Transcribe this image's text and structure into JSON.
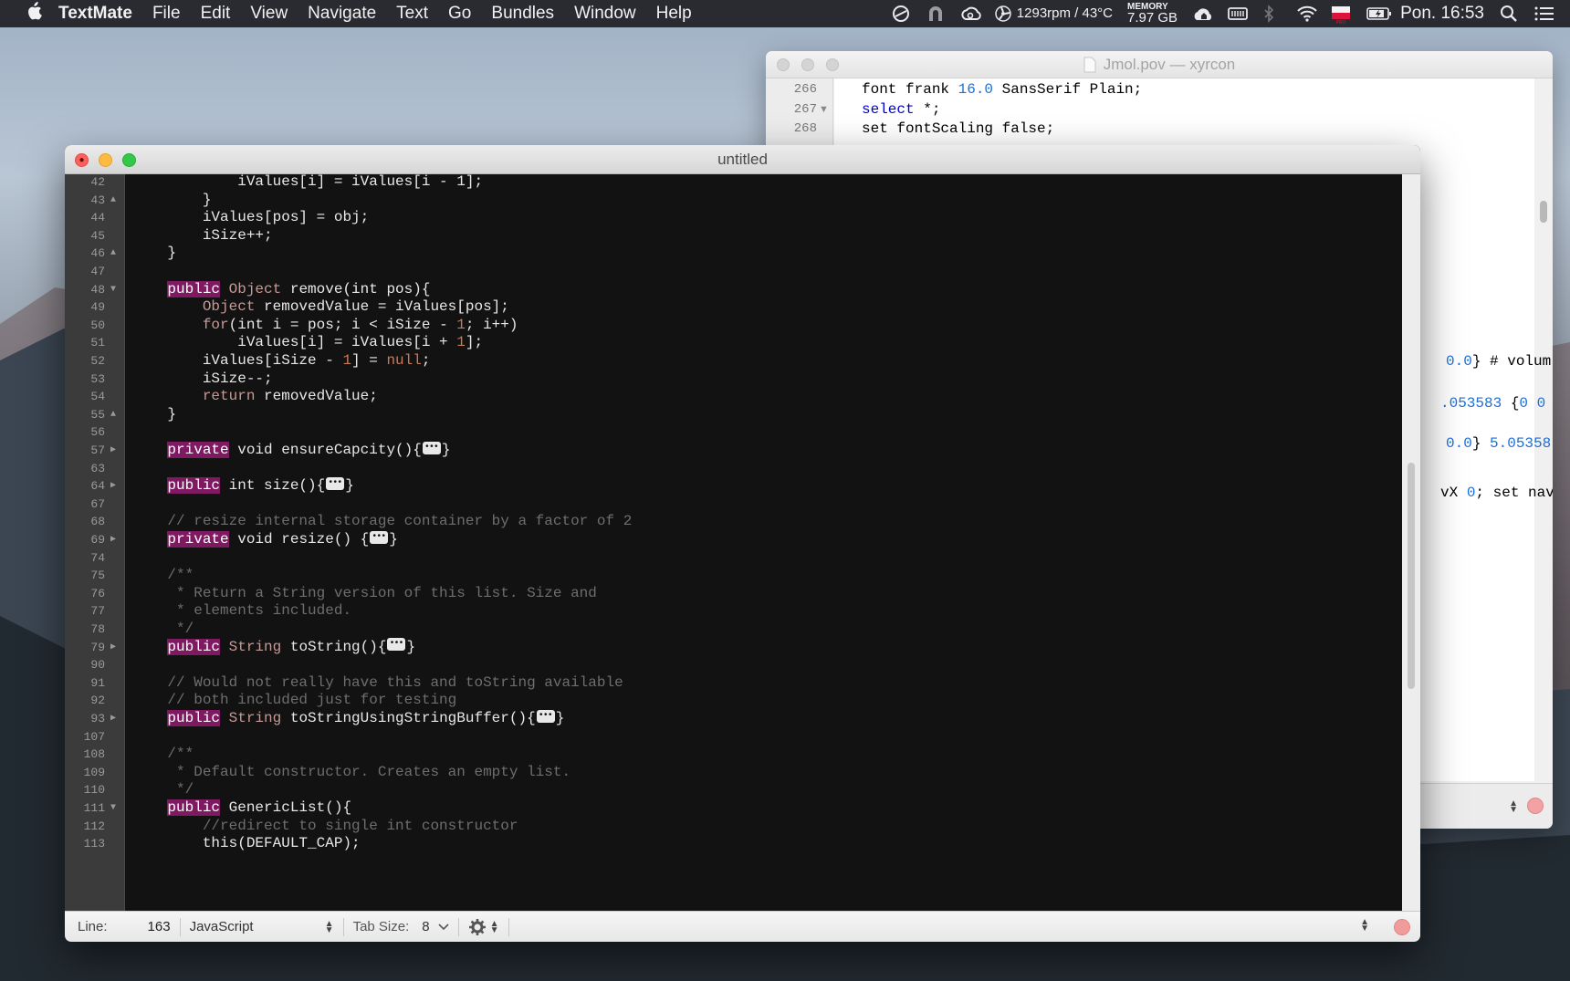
{
  "menubar": {
    "app_name": "TextMate",
    "menus": [
      "File",
      "Edit",
      "View",
      "Navigate",
      "Text",
      "Go",
      "Bundles",
      "Window",
      "Help"
    ],
    "fan_status": "1293rpm / 43°C",
    "memory_label": "MEMORY",
    "memory_value": "7.97 GB",
    "clock": "Pon. 16:53"
  },
  "back_window": {
    "title": "Jmol.pov — xyrcon",
    "lines": [
      {
        "num": "266",
        "fold": "",
        "segments": [
          {
            "t": "font frank ",
            "c": ""
          },
          {
            "t": "16.0",
            "c": "num"
          },
          {
            "t": " SansSerif Plain;",
            "c": ""
          }
        ]
      },
      {
        "num": "267",
        "fold": "▼",
        "segments": [
          {
            "t": "select",
            "c": "kw"
          },
          {
            "t": " *;",
            "c": ""
          }
        ]
      },
      {
        "num": "268",
        "fold": "",
        "segments": [
          {
            "t": "set fontScaling false;",
            "c": ""
          }
        ]
      }
    ],
    "peek_lines": [
      {
        "segments": [
          {
            "t": "0.0",
            "c": "num"
          },
          {
            "t": "} # volum",
            "c": ""
          }
        ]
      },
      {
        "segments": [
          {
            "t": ".053583",
            "c": "num"
          },
          {
            "t": " {",
            "c": ""
          },
          {
            "t": "0 0",
            "c": "num"
          }
        ]
      },
      {
        "segments": [
          {
            "t": "0.0",
            "c": "num"
          },
          {
            "t": "} ",
            "c": ""
          },
          {
            "t": "5.05358",
            "c": "num"
          }
        ]
      },
      {
        "segments": [
          {
            "t": "vX ",
            "c": ""
          },
          {
            "t": "0",
            "c": "num"
          },
          {
            "t": "; set nav",
            "c": ""
          }
        ]
      }
    ]
  },
  "front_window": {
    "title": "untitled",
    "lines": [
      {
        "num": "42",
        "fold": "",
        "segments": [
          {
            "t": "            iValues[i] = iValues[i - 1];",
            "c": "plain"
          }
        ]
      },
      {
        "num": "43",
        "fold": "▲",
        "segments": [
          {
            "t": "        }",
            "c": "plain"
          }
        ]
      },
      {
        "num": "44",
        "fold": "",
        "segments": [
          {
            "t": "        iValues[pos] = obj;",
            "c": "plain"
          }
        ]
      },
      {
        "num": "45",
        "fold": "",
        "segments": [
          {
            "t": "        iSize++;",
            "c": "plain"
          }
        ]
      },
      {
        "num": "46",
        "fold": "▲",
        "segments": [
          {
            "t": "    }",
            "c": "plain"
          }
        ]
      },
      {
        "num": "47",
        "fold": "",
        "segments": []
      },
      {
        "num": "48",
        "fold": "▼",
        "segments": [
          {
            "t": "    ",
            "c": "plain"
          },
          {
            "t": "public",
            "c": "kw"
          },
          {
            "t": " ",
            "c": "plain"
          },
          {
            "t": "Object",
            "c": "cl"
          },
          {
            "t": " remove(int pos){",
            "c": "plain"
          }
        ]
      },
      {
        "num": "49",
        "fold": "",
        "segments": [
          {
            "t": "        ",
            "c": "plain"
          },
          {
            "t": "Object",
            "c": "cl"
          },
          {
            "t": " removedValue = iValues[pos];",
            "c": "plain"
          }
        ]
      },
      {
        "num": "50",
        "fold": "",
        "segments": [
          {
            "t": "        ",
            "c": "plain"
          },
          {
            "t": "for",
            "c": "ctl"
          },
          {
            "t": "(int i = pos; i < iSize - ",
            "c": "plain"
          },
          {
            "t": "1",
            "c": "num"
          },
          {
            "t": "; i++)",
            "c": "plain"
          }
        ]
      },
      {
        "num": "51",
        "fold": "",
        "segments": [
          {
            "t": "            iValues[i] = iValues[i + ",
            "c": "plain"
          },
          {
            "t": "1",
            "c": "num"
          },
          {
            "t": "];",
            "c": "plain"
          }
        ]
      },
      {
        "num": "52",
        "fold": "",
        "segments": [
          {
            "t": "        iValues[iSize - ",
            "c": "plain"
          },
          {
            "t": "1",
            "c": "num"
          },
          {
            "t": "] = ",
            "c": "plain"
          },
          {
            "t": "null",
            "c": "num"
          },
          {
            "t": ";",
            "c": "plain"
          }
        ]
      },
      {
        "num": "53",
        "fold": "",
        "segments": [
          {
            "t": "        iSize--;",
            "c": "plain"
          }
        ]
      },
      {
        "num": "54",
        "fold": "",
        "segments": [
          {
            "t": "        ",
            "c": "plain"
          },
          {
            "t": "return",
            "c": "ctl"
          },
          {
            "t": " removedValue;",
            "c": "plain"
          }
        ]
      },
      {
        "num": "55",
        "fold": "▲",
        "segments": [
          {
            "t": "    }",
            "c": "plain"
          }
        ]
      },
      {
        "num": "56",
        "fold": "",
        "segments": []
      },
      {
        "num": "57",
        "fold": "▶",
        "segments": [
          {
            "t": "    ",
            "c": "plain"
          },
          {
            "t": "private",
            "c": "kw"
          },
          {
            "t": " void ensureCapcity(){",
            "c": "plain"
          },
          {
            "t": "",
            "c": "badge"
          },
          {
            "t": "}",
            "c": "plain"
          }
        ]
      },
      {
        "num": "63",
        "fold": "",
        "segments": []
      },
      {
        "num": "64",
        "fold": "▶",
        "segments": [
          {
            "t": "    ",
            "c": "plain"
          },
          {
            "t": "public",
            "c": "kw"
          },
          {
            "t": " int size(){",
            "c": "plain"
          },
          {
            "t": "",
            "c": "badge"
          },
          {
            "t": "}",
            "c": "plain"
          }
        ]
      },
      {
        "num": "67",
        "fold": "",
        "segments": []
      },
      {
        "num": "68",
        "fold": "",
        "segments": [
          {
            "t": "    // resize internal storage container by a factor of 2",
            "c": "cm"
          }
        ]
      },
      {
        "num": "69",
        "fold": "▶",
        "segments": [
          {
            "t": "    ",
            "c": "plain"
          },
          {
            "t": "private",
            "c": "kw"
          },
          {
            "t": " void resize() {",
            "c": "plain"
          },
          {
            "t": "",
            "c": "badge"
          },
          {
            "t": "}",
            "c": "plain"
          }
        ]
      },
      {
        "num": "74",
        "fold": "",
        "segments": []
      },
      {
        "num": "75",
        "fold": "",
        "segments": [
          {
            "t": "    /**",
            "c": "cm"
          }
        ]
      },
      {
        "num": "76",
        "fold": "",
        "segments": [
          {
            "t": "     * Return a String version of this list. Size and",
            "c": "cm"
          }
        ]
      },
      {
        "num": "77",
        "fold": "",
        "segments": [
          {
            "t": "     * elements included.",
            "c": "cm"
          }
        ]
      },
      {
        "num": "78",
        "fold": "",
        "segments": [
          {
            "t": "     */",
            "c": "cm"
          }
        ]
      },
      {
        "num": "79",
        "fold": "▶",
        "segments": [
          {
            "t": "    ",
            "c": "plain"
          },
          {
            "t": "public",
            "c": "kw"
          },
          {
            "t": " ",
            "c": "plain"
          },
          {
            "t": "String",
            "c": "cl"
          },
          {
            "t": " toString(){",
            "c": "plain"
          },
          {
            "t": "",
            "c": "badge"
          },
          {
            "t": "}",
            "c": "plain"
          }
        ]
      },
      {
        "num": "90",
        "fold": "",
        "segments": []
      },
      {
        "num": "91",
        "fold": "",
        "segments": [
          {
            "t": "    // Would not really have this and toString available",
            "c": "cm"
          }
        ]
      },
      {
        "num": "92",
        "fold": "",
        "segments": [
          {
            "t": "    // both included just for testing",
            "c": "cm"
          }
        ]
      },
      {
        "num": "93",
        "fold": "▶",
        "segments": [
          {
            "t": "    ",
            "c": "plain"
          },
          {
            "t": "public",
            "c": "kw"
          },
          {
            "t": " ",
            "c": "plain"
          },
          {
            "t": "String",
            "c": "cl"
          },
          {
            "t": " toStringUsingStringBuffer(){",
            "c": "plain"
          },
          {
            "t": "",
            "c": "badge"
          },
          {
            "t": "}",
            "c": "plain"
          }
        ]
      },
      {
        "num": "107",
        "fold": "",
        "segments": []
      },
      {
        "num": "108",
        "fold": "",
        "segments": [
          {
            "t": "    /**",
            "c": "cm"
          }
        ]
      },
      {
        "num": "109",
        "fold": "",
        "segments": [
          {
            "t": "     * Default constructor. Creates an empty list.",
            "c": "cm"
          }
        ]
      },
      {
        "num": "110",
        "fold": "",
        "segments": [
          {
            "t": "     */",
            "c": "cm"
          }
        ]
      },
      {
        "num": "111",
        "fold": "▼",
        "segments": [
          {
            "t": "    ",
            "c": "plain"
          },
          {
            "t": "public",
            "c": "kw"
          },
          {
            "t": " GenericList(){",
            "c": "plain"
          }
        ]
      },
      {
        "num": "112",
        "fold": "",
        "segments": [
          {
            "t": "        //redirect to single int constructor",
            "c": "cm"
          }
        ]
      },
      {
        "num": "113",
        "fold": "",
        "segments": [
          {
            "t": "        this(DEFAULT_CAP);",
            "c": "plain"
          }
        ]
      }
    ]
  },
  "status_bar": {
    "line_label": "Line:",
    "line_value": "163",
    "language": "JavaScript",
    "tab_label": "Tab Size:",
    "tab_value": "8"
  }
}
